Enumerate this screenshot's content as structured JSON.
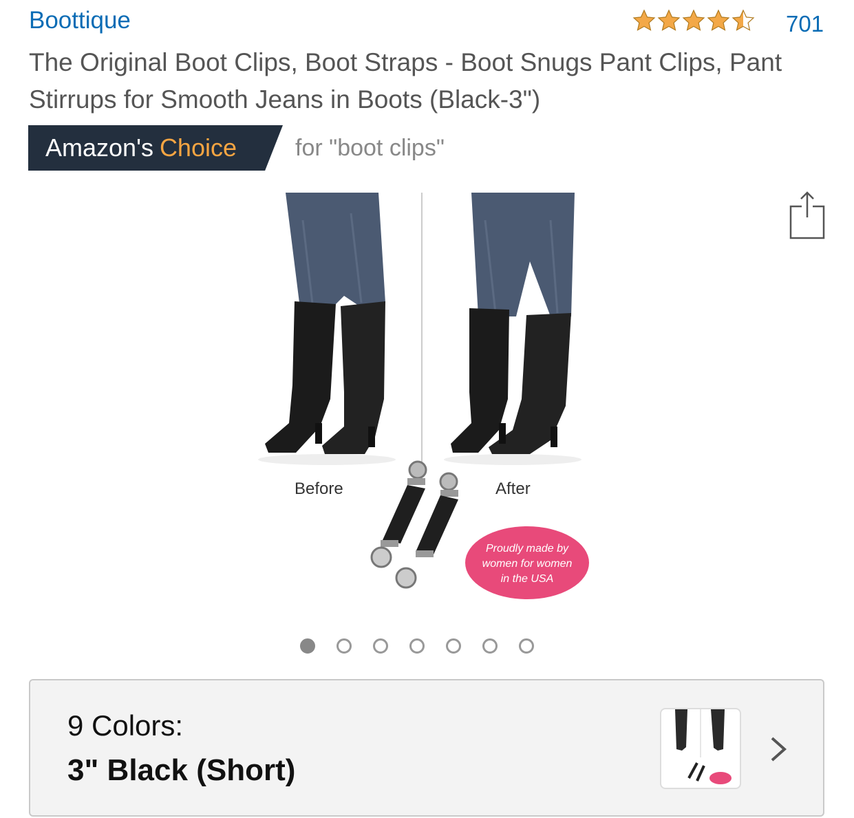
{
  "header": {
    "brand": "Boottique",
    "rating": 4.5,
    "rating_count": "701",
    "title": "The Original Boot Clips, Boot Straps - Boot Snugs Pant Clips, Pant Stirrups for Smooth Jeans in Boots (Black-3\")"
  },
  "badge": {
    "label_part1": "Amazon's",
    "label_part2": "Choice",
    "for_text": "for \"boot clips\""
  },
  "image": {
    "before_label": "Before",
    "after_label": "After",
    "sticker_line1": "Proudly made by",
    "sticker_line2": "women for women",
    "sticker_line3": "in the USA"
  },
  "carousel": {
    "count": 7,
    "active": 1
  },
  "colors": {
    "label": "9 Colors:",
    "selected": "3\" Black (Short)"
  },
  "theme": {
    "link_color": "#0a6cb5",
    "badge_bg": "#232f3e",
    "badge_accent": "#f7a542",
    "star_color": "#f3a847"
  }
}
